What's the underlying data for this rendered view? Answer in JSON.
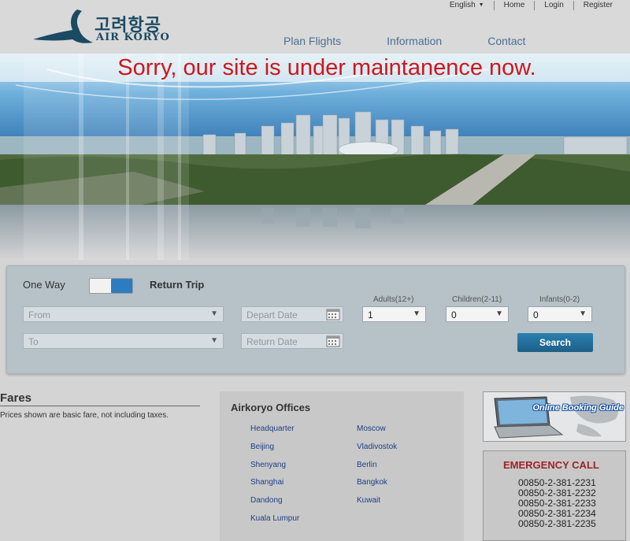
{
  "header": {
    "logo_korean": "고려항공",
    "logo_english": "AIR KORYO",
    "language": "English",
    "utility_links": [
      "Home",
      "Login",
      "Register"
    ],
    "nav": [
      "Plan Flights",
      "Information",
      "Contact"
    ]
  },
  "banner": {
    "maintenance_message": "Sorry, our site is under maintanence now."
  },
  "search": {
    "one_way_label": "One Way",
    "return_trip_label": "Return Trip",
    "from_placeholder": "From",
    "to_placeholder": "To",
    "depart_placeholder": "Depart Date",
    "return_placeholder": "Return Date",
    "adults_label": "Adults(12+)",
    "children_label": "Children(2-11)",
    "infants_label": "Infants(0-2)",
    "adults_value": "1",
    "children_value": "0",
    "infants_value": "0",
    "search_button": "Search"
  },
  "fares": {
    "title": "Fares",
    "note": "Prices shown are basic fare, not including taxes."
  },
  "offices": {
    "title": "Airkoryo Offices",
    "left": [
      "Headquarter",
      "Beijing",
      "Shenyang",
      "Shanghai",
      "Dandong",
      "Kuala Lumpur"
    ],
    "right": [
      "Moscow",
      "Vladivostok",
      "Berlin",
      "Bangkok",
      "Kuwait"
    ]
  },
  "booking_guide": {
    "label": "Online Booking Guide"
  },
  "emergency": {
    "title": "EMERGENCY CALL",
    "numbers": [
      "00850-2-381-2231",
      "00850-2-381-2232",
      "00850-2-381-2233",
      "00850-2-381-2234",
      "00850-2-381-2235"
    ]
  },
  "colors": {
    "accent_blue": "#2d7cc1",
    "alert_red": "#d0161c",
    "brand_navy": "#1b4a63"
  }
}
